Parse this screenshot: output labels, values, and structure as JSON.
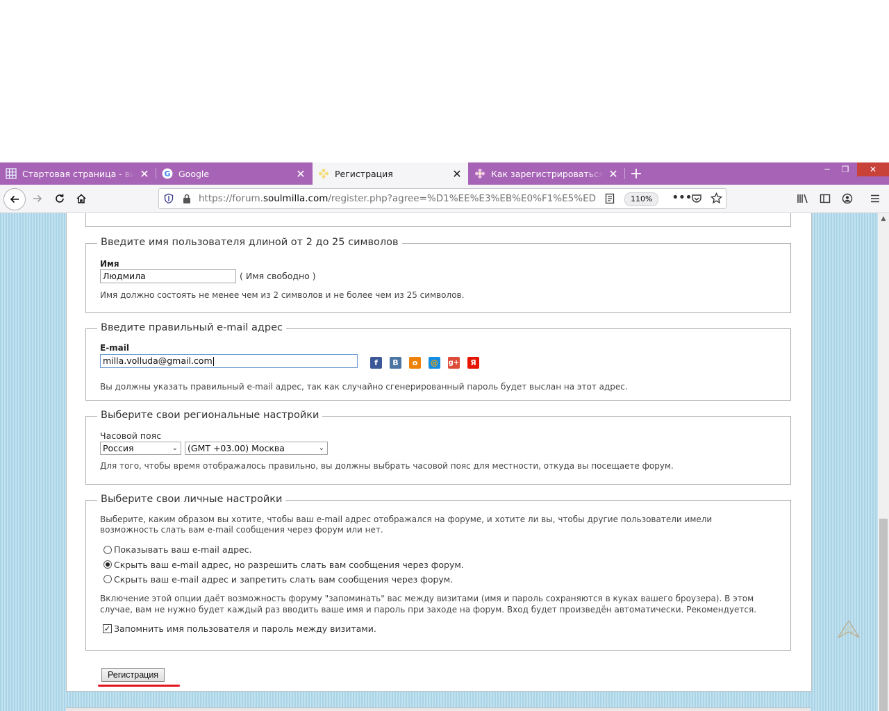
{
  "browser": {
    "tabs": [
      {
        "label": "Стартовая страница - визуальные закладки",
        "active": false
      },
      {
        "label": "Google",
        "active": false
      },
      {
        "label": "Регистрация",
        "active": true
      },
      {
        "label": "Как зарегистрироваться на форуме",
        "active": false
      }
    ],
    "url": {
      "prefix": "https://forum.",
      "domain": "soulmilla.com",
      "path": "/register.php?agree=%D1%EE%E3%EB%E0%F1%E5%ED"
    },
    "zoom": "110%"
  },
  "form": {
    "username": {
      "legend": "Введите имя пользователя длиной от 2 до 25 символов",
      "label": "Имя",
      "value": "Людмила",
      "status": "( Имя свободно )",
      "hint": "Имя должно состоять не менее чем из 2 символов и не более чем из 25 символов."
    },
    "email": {
      "legend": "Введите правильный e-mail адрес",
      "label": "E-mail",
      "value": "milla.volluda@gmail.com",
      "hint": "Вы должны указать правильный e-mail адрес, так как случайно сгенерированный пароль будет выслан на этот адрес.",
      "social": [
        {
          "name": "facebook",
          "glyph": "f",
          "color": "#3b5998"
        },
        {
          "name": "vkontakte",
          "glyph": "B",
          "color": "#4c75a3"
        },
        {
          "name": "odnoklassniki",
          "glyph": "о",
          "color": "#ee8208"
        },
        {
          "name": "mailru",
          "glyph": "@",
          "color": "#168de2"
        },
        {
          "name": "googleplus",
          "glyph": "g+",
          "color": "#dd4b39"
        },
        {
          "name": "yandex",
          "glyph": "Я",
          "color": "#e61400"
        }
      ]
    },
    "region": {
      "legend": "Выберите свои региональные настройки",
      "label": "Часовой пояс",
      "country": "Россия",
      "timezone": "(GMT +03.00) Москва",
      "hint": "Для того, чтобы время отображалось правильно, вы должны выбрать часовой пояс для местности, откуда вы посещаете форум."
    },
    "personal": {
      "legend": "Выберите свои личные настройки",
      "intro_line1": "Выберите, каким образом вы хотите, чтобы ваш e-mail адрес отображался на форуме, и хотите ли вы, чтобы другие пользователи имели",
      "intro_line2": "возможность слать вам e-mail сообщения через форум или нет.",
      "options": [
        {
          "label": "Показывать ваш e-mail адрес.",
          "checked": false
        },
        {
          "label": "Скрыть ваш e-mail адрес, но разрешить слать вам сообщения через форум.",
          "checked": true
        },
        {
          "label": "Скрыть ваш e-mail адрес и запретить слать вам сообщения через форум.",
          "checked": false
        }
      ],
      "remember_line1": "Включение этой опции даёт возможность форуму \"запоминать\" вас между визитами (имя и пароль сохраняются в куках вашего броузера). В этом",
      "remember_line2": "случае, вам не нужно будет каждый раз вводить ваше имя и пароль при заходе на форум. Вход будет произведён автоматически. Рекомендуется.",
      "remember_label": "Запомнить имя пользователя и пароль между визитами.",
      "remember_checked": true
    },
    "submit_label": "Регистрация"
  }
}
